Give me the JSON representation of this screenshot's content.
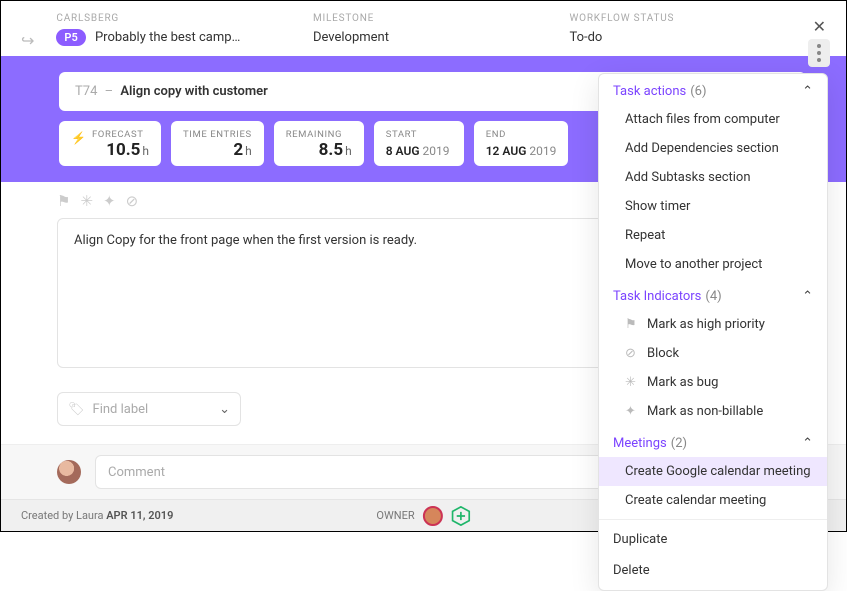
{
  "header": {
    "project_label": "CARLSBERG",
    "priority_badge": "P5",
    "campaign_title": "Probably the best camp…",
    "milestone_label": "MILESTONE",
    "milestone_value": "Development",
    "workflow_label": "WORKFLOW STATUS",
    "workflow_value": "To-do"
  },
  "task": {
    "id": "T74",
    "sep": "–",
    "title": "Align copy with customer"
  },
  "stats": {
    "forecast_label": "FORECAST",
    "forecast_value": "10.5",
    "forecast_unit": "h",
    "entries_label": "TIME ENTRIES",
    "entries_value": "2",
    "entries_unit": "h",
    "remaining_label": "REMAINING",
    "remaining_value": "8.5",
    "remaining_unit": "h",
    "start_label": "START",
    "start_day": "8",
    "start_month": "AUG",
    "start_year": "2019",
    "end_label": "END",
    "end_day": "12",
    "end_month": "AUG",
    "end_year": "2019"
  },
  "description": "Align Copy for the front page when the first version is ready.",
  "find_label_placeholder": "Find label",
  "comment_placeholder": "Comment",
  "footer": {
    "created_prefix": "Created by Laura",
    "created_date": "APR 11, 2019",
    "owner_label": "OWNER"
  },
  "menu": {
    "task_actions": {
      "title": "Task actions",
      "count": "(6)"
    },
    "actions": {
      "attach": "Attach files from computer",
      "deps": "Add Dependencies section",
      "subtasks": "Add Subtasks section",
      "timer": "Show timer",
      "repeat": "Repeat",
      "move": "Move to another project"
    },
    "indicators_head": {
      "title": "Task Indicators",
      "count": "(4)"
    },
    "indicators": {
      "priority": "Mark as high priority",
      "block": "Block",
      "bug": "Mark as bug",
      "nonbill": "Mark as non-billable"
    },
    "meetings_head": {
      "title": "Meetings",
      "count": "(2)"
    },
    "meetings": {
      "google": "Create Google calendar meeting",
      "plain": "Create calendar meeting"
    },
    "footer": {
      "duplicate": "Duplicate",
      "delete": "Delete"
    }
  }
}
